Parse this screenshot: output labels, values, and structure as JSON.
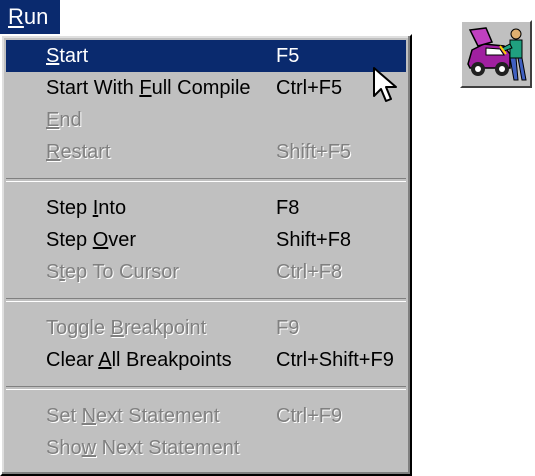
{
  "menu": {
    "title_prefix": "",
    "title_access": "R",
    "title_rest": "un",
    "items": [
      {
        "pre": "",
        "key": "S",
        "post": "tart",
        "accel": "F5",
        "state": "selected"
      },
      {
        "pre": "Start With ",
        "key": "F",
        "post": "ull Compile",
        "accel": "Ctrl+F5",
        "state": "enabled"
      },
      {
        "pre": "",
        "key": "E",
        "post": "nd",
        "accel": "",
        "state": "disabled"
      },
      {
        "pre": "",
        "key": "R",
        "post": "estart",
        "accel": "Shift+F5",
        "state": "disabled"
      },
      {
        "pre": "Step ",
        "key": "I",
        "post": "nto",
        "accel": "F8",
        "state": "enabled"
      },
      {
        "pre": "Step ",
        "key": "O",
        "post": "ver",
        "accel": "Shift+F8",
        "state": "enabled"
      },
      {
        "pre": "S",
        "key": "t",
        "post": "ep To Cursor",
        "accel": "Ctrl+F8",
        "state": "disabled"
      },
      {
        "pre": "Toggle ",
        "key": "B",
        "post": "reakpoint",
        "accel": "F9",
        "state": "disabled"
      },
      {
        "pre": "Clear ",
        "key": "A",
        "post": "ll Breakpoints",
        "accel": "Ctrl+Shift+F9",
        "state": "enabled"
      },
      {
        "pre": "Set ",
        "key": "N",
        "post": "ext Statement",
        "accel": "Ctrl+F9",
        "state": "disabled"
      },
      {
        "pre": "Sho",
        "key": "w",
        "post": " Next Statement",
        "accel": "",
        "state": "disabled"
      }
    ]
  },
  "icons": {
    "cursor": "arrow-cursor-icon",
    "app": "mechanic-car-icon"
  },
  "colors": {
    "highlight": "#0a2a6e",
    "menu_bg": "#c0c0c0",
    "disabled_text": "#808080"
  }
}
